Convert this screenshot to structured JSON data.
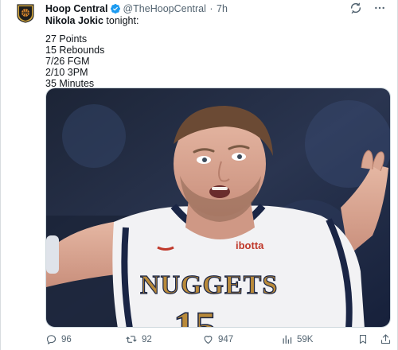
{
  "tweet": {
    "author_name": "Hoop Central",
    "handle": "@TheHoopCentral",
    "separator": "·",
    "time": "7h",
    "subject": "Nikola Jokic",
    "text_after_subject": " tonight:",
    "stats": [
      "27 Points",
      "15 Rebounds",
      "7/26 FGM",
      "2/10 3PM",
      "35 Minutes"
    ]
  },
  "image": {
    "jersey_team": "NUGGETS",
    "jersey_sponsor": "ibotta",
    "jersey_number": "15"
  },
  "actions": {
    "replies": "96",
    "reposts": "92",
    "likes": "947",
    "views": "59K"
  },
  "colors": {
    "verified": "#1d9bf0",
    "text": "#0f1419",
    "secondary": "#536471",
    "jersey_white": "#f2f2f4",
    "jersey_navy": "#1a2545",
    "jersey_gold": "#b98a3a"
  },
  "icons": {
    "avatar": "hoop-central-logo-icon",
    "verified": "verified-badge-icon",
    "grok": "grok-icon",
    "more": "more-icon",
    "reply": "reply-icon",
    "repost": "repost-icon",
    "like": "like-icon",
    "views": "views-icon",
    "bookmark": "bookmark-icon",
    "share": "share-icon"
  }
}
